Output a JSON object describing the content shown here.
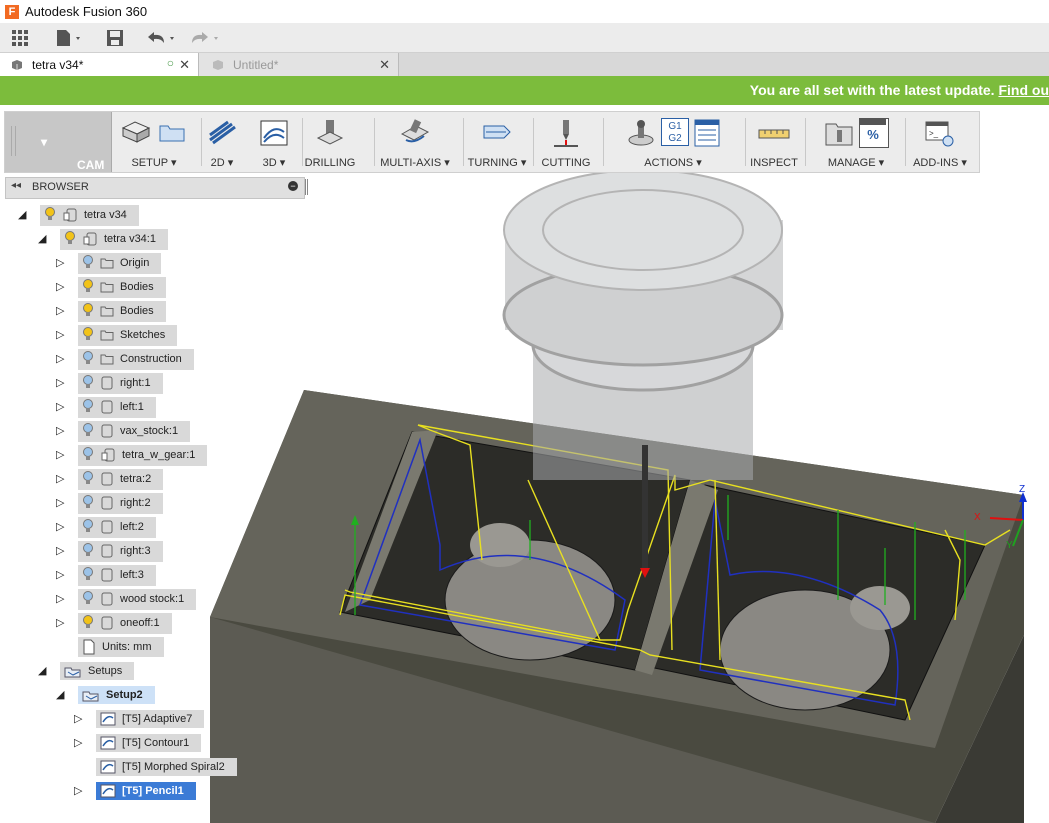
{
  "app": {
    "title": "Autodesk Fusion 360",
    "icon_letter": "F"
  },
  "tabs": [
    {
      "label": "tetra v34*",
      "active": true
    },
    {
      "label": "Untitled*",
      "active": false
    }
  ],
  "banner": {
    "message": "You are all set with the latest update. ",
    "link": "Find ou"
  },
  "toolbar": {
    "workspace": "CAM",
    "groups": [
      {
        "label": "SETUP",
        "dropdown": true
      },
      {
        "label": "2D",
        "dropdown": true
      },
      {
        "label": "3D",
        "dropdown": true
      },
      {
        "label": "DRILLING",
        "dropdown": false
      },
      {
        "label": "MULTI-AXIS",
        "dropdown": true
      },
      {
        "label": "TURNING",
        "dropdown": true
      },
      {
        "label": "CUTTING",
        "dropdown": false
      },
      {
        "label": "ACTIONS",
        "dropdown": true
      },
      {
        "label": "INSPECT",
        "dropdown": false
      },
      {
        "label": "MANAGE",
        "dropdown": true
      },
      {
        "label": "ADD-INS",
        "dropdown": true
      }
    ],
    "g1g2_text": "G1 G2"
  },
  "browser": {
    "title": "BROWSER",
    "nodes": [
      {
        "label": "tetra v34",
        "indent": 0,
        "expanded": true,
        "bulb": "on",
        "icon": "component"
      },
      {
        "label": "tetra v34:1",
        "indent": 1,
        "expanded": true,
        "bulb": "on",
        "icon": "component"
      },
      {
        "label": "Origin",
        "indent": 2,
        "expanded": false,
        "bulb": "off",
        "icon": "folder"
      },
      {
        "label": "Bodies",
        "indent": 2,
        "expanded": false,
        "bulb": "on",
        "icon": "folder"
      },
      {
        "label": "Bodies",
        "indent": 2,
        "expanded": false,
        "bulb": "on",
        "icon": "folder"
      },
      {
        "label": "Sketches",
        "indent": 2,
        "expanded": false,
        "bulb": "on",
        "icon": "folder"
      },
      {
        "label": "Construction",
        "indent": 2,
        "expanded": false,
        "bulb": "off",
        "icon": "folder"
      },
      {
        "label": "right:1",
        "indent": 2,
        "expanded": false,
        "bulb": "off",
        "icon": "body"
      },
      {
        "label": "left:1",
        "indent": 2,
        "expanded": false,
        "bulb": "off",
        "icon": "body"
      },
      {
        "label": "vax_stock:1",
        "indent": 2,
        "expanded": false,
        "bulb": "off",
        "icon": "body"
      },
      {
        "label": "tetra_w_gear:1",
        "indent": 2,
        "expanded": false,
        "bulb": "off",
        "icon": "component"
      },
      {
        "label": "tetra:2",
        "indent": 2,
        "expanded": false,
        "bulb": "off",
        "icon": "body"
      },
      {
        "label": "right:2",
        "indent": 2,
        "expanded": false,
        "bulb": "off",
        "icon": "body"
      },
      {
        "label": "left:2",
        "indent": 2,
        "expanded": false,
        "bulb": "off",
        "icon": "body"
      },
      {
        "label": "right:3",
        "indent": 2,
        "expanded": false,
        "bulb": "off",
        "icon": "body"
      },
      {
        "label": "left:3",
        "indent": 2,
        "expanded": false,
        "bulb": "off",
        "icon": "body"
      },
      {
        "label": "wood stock:1",
        "indent": 2,
        "expanded": false,
        "bulb": "off",
        "icon": "body"
      },
      {
        "label": "oneoff:1",
        "indent": 2,
        "expanded": false,
        "bulb": "on",
        "icon": "body"
      },
      {
        "label": "Units: mm",
        "indent": 2,
        "expanded": null,
        "bulb": null,
        "icon": "doc"
      },
      {
        "label": "Setups",
        "indent": 1,
        "expanded": true,
        "bulb": null,
        "icon": "setups"
      },
      {
        "label": "Setup2",
        "indent": 2,
        "expanded": true,
        "bulb": null,
        "icon": "setups",
        "style": "hl"
      },
      {
        "label": "[T5] Adaptive7",
        "indent": 3,
        "expanded": false,
        "bulb": null,
        "icon": "op"
      },
      {
        "label": "[T5] Contour1",
        "indent": 3,
        "expanded": false,
        "bulb": null,
        "icon": "op"
      },
      {
        "label": "[T5] Morphed Spiral2",
        "indent": 3,
        "expanded": null,
        "bulb": null,
        "icon": "op"
      },
      {
        "label": "[T5] Pencil1",
        "indent": 3,
        "expanded": false,
        "bulb": null,
        "icon": "op",
        "style": "sel"
      }
    ]
  },
  "viewcube": {
    "axes": [
      "X",
      "Y",
      "Z"
    ]
  },
  "colors": {
    "banner": "#7cbc3c",
    "selection": "#3b7bd6",
    "toolpath": "#e8e020",
    "cutpath": "#2030c0",
    "retract": "#20b020"
  }
}
